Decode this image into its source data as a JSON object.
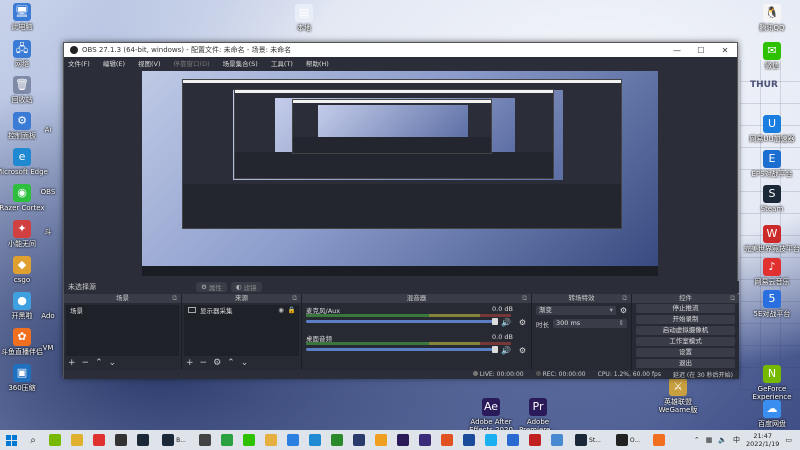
{
  "desktop": {
    "calendar_label": "THUR",
    "left_icons": [
      {
        "label": "此电脑",
        "glyph": "🖥",
        "color": "#3a7bd5"
      },
      {
        "label": "网络",
        "glyph": "🖧",
        "color": "#3a7bd5"
      },
      {
        "label": "回收站",
        "glyph": "🗑",
        "color": "#7e8aa8"
      },
      {
        "label": "控制面板",
        "glyph": "⚙",
        "color": "#3a7bd5"
      },
      {
        "label": "Microsoft Edge",
        "glyph": "e",
        "color": "#1f8ad1"
      },
      {
        "label": "Razer Cortex",
        "glyph": "◉",
        "color": "#2fbf3f"
      },
      {
        "label": "小能无间",
        "glyph": "✦",
        "color": "#d04040"
      },
      {
        "label": "csgo",
        "glyph": "◆",
        "color": "#e0a030"
      },
      {
        "label": "开黑啦",
        "glyph": "●",
        "color": "#3fa0e0"
      },
      {
        "label": "斗鱼直播伴侣",
        "glyph": "✿",
        "color": "#f07020"
      },
      {
        "label": "360压缩",
        "glyph": "▣",
        "color": "#2070c0"
      }
    ],
    "left_partial": [
      {
        "label": "Ai",
        "glyph": "",
        "color": "#333"
      },
      {
        "label": "OBS",
        "glyph": "",
        "color": "#333"
      },
      {
        "label": "斗",
        "glyph": "",
        "color": "#333"
      },
      {
        "label": "Ado",
        "glyph": "",
        "color": "#333"
      },
      {
        "label": "VM",
        "glyph": "",
        "color": "#333"
      }
    ],
    "top_icon": {
      "label": "本地",
      "glyph": "▤",
      "color": "#e8eef8"
    },
    "right_icons": [
      {
        "label": "腾讯QQ",
        "glyph": "🐧",
        "color": "#f5f5f5"
      },
      {
        "label": "微信",
        "glyph": "✉",
        "color": "#2dc100"
      },
      {
        "label": "网易UU加速器",
        "glyph": "U",
        "color": "#1a7de0"
      },
      {
        "label": "EPS对战平台",
        "glyph": "E",
        "color": "#1c6fd0"
      },
      {
        "label": "Steam",
        "glyph": "S",
        "color": "#1b2838"
      },
      {
        "label": "完美世界竞技平台",
        "glyph": "W",
        "color": "#cc2a2a"
      },
      {
        "label": "网易云音乐",
        "glyph": "♪",
        "color": "#e03030"
      },
      {
        "label": "5E对战平台",
        "glyph": "5",
        "color": "#2a6fe0"
      },
      {
        "label": "GeForce Experience",
        "glyph": "N",
        "color": "#76b900"
      },
      {
        "label": "百度网盘",
        "glyph": "☁",
        "color": "#3a8ef0"
      }
    ],
    "bottom_icons": [
      {
        "label": "Adobe After Effects 2020",
        "glyph": "Ae",
        "color": "#2a1a5a"
      },
      {
        "label": "Adobe Premiere...",
        "glyph": "Pr",
        "color": "#2a1a5a"
      },
      {
        "label": "英雄联盟WeGame版",
        "glyph": "⚔",
        "color": "#c8a040"
      }
    ]
  },
  "obs": {
    "title": "OBS 27.1.3 (64-bit, windows) - 配置文件: 未命名 - 场景: 未命名",
    "window_buttons": [
      "—",
      "☐",
      "✕"
    ],
    "menu": [
      "文件(F)",
      "编辑(E)",
      "视图(V)",
      "停靠窗口(D)",
      "场景集合(S)",
      "工具(T)",
      "帮助(H)"
    ],
    "menu_disabled_index": 3,
    "scene_info": {
      "no_source": "未选择源",
      "properties_btn": "属性",
      "filters_btn": "滤镜"
    },
    "scenes": {
      "title": "场景",
      "items": [
        "场景"
      ]
    },
    "sources": {
      "title": "来源",
      "items": [
        "显示器采集"
      ]
    },
    "mixer": {
      "title": "混音器",
      "channels": [
        {
          "name": "麦克风/Aux",
          "db": "0.0 dB"
        },
        {
          "name": "桌面音频",
          "db": "0.0 dB"
        }
      ]
    },
    "transitions": {
      "title": "转场特效",
      "type": "渐变",
      "duration_label": "时长",
      "duration_value": "300 ms"
    },
    "controls": {
      "title": "控件",
      "buttons": [
        "停止推流",
        "开始录制",
        "启动虚拟摄像机",
        "工作室模式",
        "设置",
        "退出"
      ]
    },
    "status": {
      "live": "LIVE: 00:00:00",
      "rec": "REC: 00:00:00",
      "cpu": "CPU: 1.2%, 60.00 fps",
      "delay": "延迟 (在 30 秒后开始)"
    }
  },
  "taskbar": {
    "apps": [
      {
        "name": "search-icon",
        "glyph": "⌕",
        "color": "#222"
      },
      {
        "name": "nvidia-icon",
        "glyph": "",
        "color": "#76b900"
      },
      {
        "name": "wegame-icon",
        "glyph": "",
        "color": "#e0b030"
      },
      {
        "name": "netease-music-icon",
        "glyph": "",
        "color": "#e03030"
      },
      {
        "name": "obs-icon",
        "glyph": "",
        "color": "#333"
      },
      {
        "name": "steam-icon",
        "glyph": "",
        "color": "#1b2838"
      },
      {
        "name": "bilibili-icon",
        "glyph": "",
        "color": "#1b2838",
        "label": "B..."
      },
      {
        "name": "epic-icon",
        "glyph": "",
        "color": "#444"
      },
      {
        "name": "360-icon",
        "glyph": "",
        "color": "#2aa040"
      },
      {
        "name": "wechat-icon",
        "glyph": "",
        "color": "#2dc100"
      },
      {
        "name": "folder-icon",
        "glyph": "",
        "color": "#e6b040"
      },
      {
        "name": "chrome-icon",
        "glyph": "",
        "color": "#2a7fe0"
      },
      {
        "name": "edge-icon",
        "glyph": "",
        "color": "#1f8ad1"
      },
      {
        "name": "xbox-icon",
        "glyph": "",
        "color": "#2a8a2a"
      },
      {
        "name": "ps-icon",
        "glyph": "",
        "color": "#2a3a6a"
      },
      {
        "name": "csgo-icon",
        "glyph": "",
        "color": "#f0a020"
      },
      {
        "name": "pr-icon",
        "glyph": "",
        "color": "#2a1a5a"
      },
      {
        "name": "ae-icon",
        "glyph": "",
        "color": "#3a2a7a"
      },
      {
        "name": "office-icon",
        "glyph": "",
        "color": "#e05020"
      },
      {
        "name": "ps2-icon",
        "glyph": "",
        "color": "#1a4a9a"
      },
      {
        "name": "qq-icon",
        "glyph": "",
        "color": "#1ab0f0"
      },
      {
        "name": "uu-icon",
        "glyph": "",
        "color": "#2a6ad0"
      },
      {
        "name": "wyy-icon",
        "glyph": "",
        "color": "#c02020"
      },
      {
        "name": "file-icon",
        "glyph": "",
        "color": "#4a8ad0"
      },
      {
        "name": "steam2-icon",
        "glyph": "",
        "color": "#1b2838",
        "label": "St..."
      },
      {
        "name": "obs2-icon",
        "glyph": "",
        "color": "#222",
        "label": "O..."
      },
      {
        "name": "orange-icon",
        "glyph": "",
        "color": "#f07020"
      }
    ],
    "clock_time": "21:47",
    "clock_date": "2022/1/19"
  }
}
